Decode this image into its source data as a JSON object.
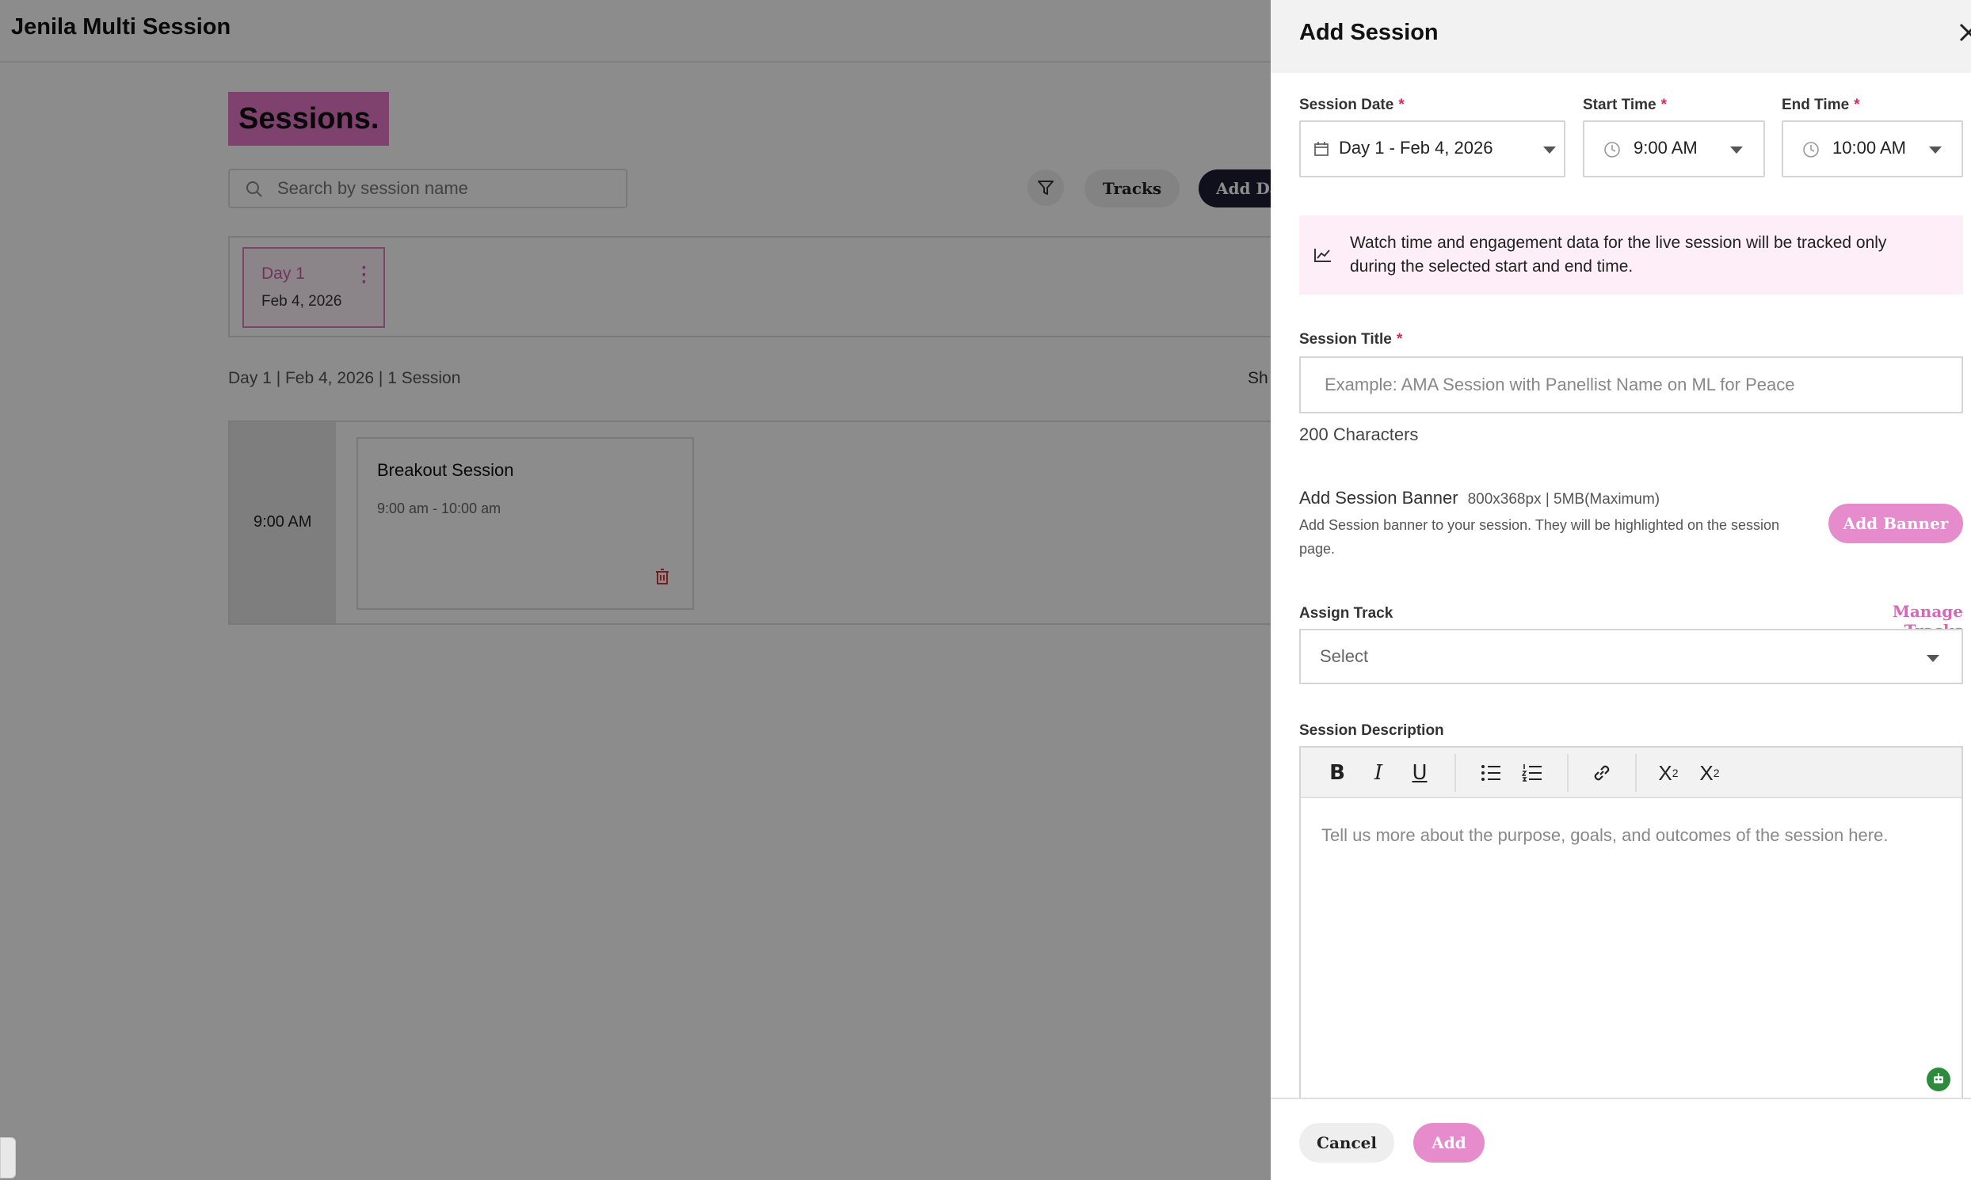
{
  "app": {
    "title": "Jenila Multi Session"
  },
  "page": {
    "heading": "Sessions.",
    "search_placeholder": "Search by session name",
    "tracks_label": "Tracks",
    "add_day_label": "Add Da",
    "day_card": {
      "label": "Day 1",
      "date": "Feb 4, 2026"
    },
    "day_summary": "Day 1 | Feb 4, 2026 | 1 Session",
    "show_label": "Sh",
    "time_slot": "9:00 AM",
    "session_card": {
      "title": "Breakout Session",
      "time": "9:00 am - 10:00 am"
    }
  },
  "drawer": {
    "title": "Add Session",
    "session_date": {
      "label": "Session Date",
      "value": "Day 1 - Feb 4, 2026"
    },
    "start_time": {
      "label": "Start Time",
      "value": "9:00 AM"
    },
    "end_time": {
      "label": "End Time",
      "value": "10:00 AM"
    },
    "required_mark": "*",
    "info_text": "Watch time and engagement data for the live session will be tracked only during the selected start and end time.",
    "session_title": {
      "label": "Session Title",
      "placeholder": "Example: AMA Session with Panellist Name on ML for Peace",
      "char_limit": "200 Characters"
    },
    "banner": {
      "heading": "Add Session Banner",
      "spec": "800x368px | 5MB(Maximum)",
      "description": "Add Session banner to your session. They will be highlighted on the session page.",
      "button": "Add Banner"
    },
    "track": {
      "label": "Assign Track",
      "manage_link": "Manage Tracks",
      "placeholder": "Select"
    },
    "description": {
      "label": "Session Description",
      "placeholder": "Tell us more about the purpose, goals, and outcomes of the session here."
    },
    "footer": {
      "cancel": "Cancel",
      "add": "Add"
    }
  },
  "colors": {
    "accent": "#e68ccc",
    "heading_bg": "#e879c8",
    "dark_button": "#1e1e35",
    "info_bg": "#fdeef7",
    "required": "#e0245e"
  }
}
